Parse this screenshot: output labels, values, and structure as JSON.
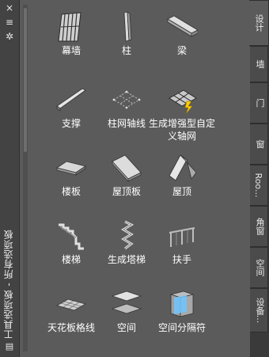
{
  "sidebar": {
    "close_icon": "×",
    "menu_icon": "≡",
    "pin_icon": "✲",
    "title": "工具选项板 - 所有选项板",
    "properties_icon": "▤"
  },
  "tools": [
    {
      "label": "幕墙",
      "icon": "curtain-wall-icon"
    },
    {
      "label": "柱",
      "icon": "column-icon"
    },
    {
      "label": "梁",
      "icon": "beam-icon"
    },
    {
      "label": "支撑",
      "icon": "brace-icon"
    },
    {
      "label": "柱网轴线",
      "icon": "column-grid-icon"
    },
    {
      "label": "生成增强型自定义轴网",
      "icon": "enhanced-grid-icon"
    },
    {
      "label": "楼板",
      "icon": "slab-icon"
    },
    {
      "label": "屋顶板",
      "icon": "roof-slab-icon"
    },
    {
      "label": "屋顶",
      "icon": "roof-icon"
    },
    {
      "label": "楼梯",
      "icon": "stair-icon"
    },
    {
      "label": "生成塔梯",
      "icon": "tower-stair-icon"
    },
    {
      "label": "扶手",
      "icon": "railing-icon"
    },
    {
      "label": "天花板格线",
      "icon": "ceiling-grid-icon"
    },
    {
      "label": "空间",
      "icon": "space-icon"
    },
    {
      "label": "空间分隔符",
      "icon": "space-separator-icon"
    }
  ],
  "tabs": [
    {
      "label": "设计",
      "active": true
    },
    {
      "label": "墙",
      "active": false
    },
    {
      "label": "门",
      "active": false
    },
    {
      "label": "窗",
      "active": false
    },
    {
      "label": "Roo...",
      "active": false
    },
    {
      "label": "角窗",
      "active": false
    },
    {
      "label": "空间",
      "active": false
    },
    {
      "label": "设备...",
      "active": false
    }
  ]
}
